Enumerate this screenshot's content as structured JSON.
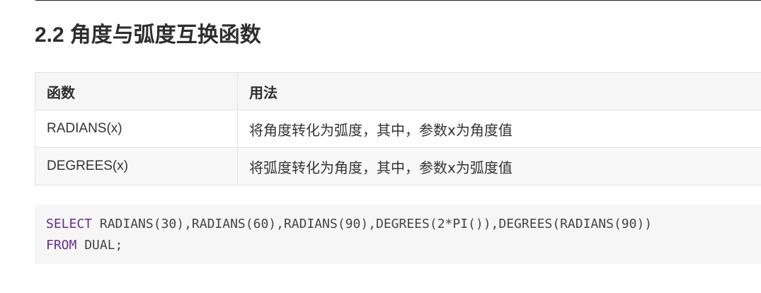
{
  "section": {
    "number": "2.2",
    "title": "角度与弧度互换函数"
  },
  "table": {
    "headers": [
      "函数",
      "用法"
    ],
    "rows": [
      {
        "function": "RADIANS(x)",
        "usage": "将角度转化为弧度，其中，参数x为角度值"
      },
      {
        "function": "DEGREES(x)",
        "usage": "将弧度转化为角度，其中，参数x为弧度值"
      }
    ]
  },
  "code": {
    "line1_keyword": "SELECT",
    "line1_rest": " RADIANS(30),RADIANS(60),RADIANS(90),DEGREES(2*PI()),DEGREES(RADIANS(90))",
    "line2_keyword": "FROM",
    "line2_rest": " DUAL;"
  }
}
